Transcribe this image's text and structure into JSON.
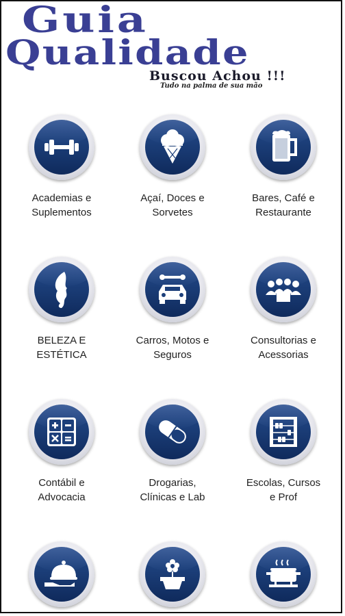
{
  "header": {
    "title_line1": "Guia",
    "title_line2": "Qualidade",
    "slogan": "Buscou Achou !!!",
    "tagline": "Tudo na palma de sua mão"
  },
  "categories": [
    {
      "line1": "Academias e",
      "line2": "Suplementos",
      "icon": "dumbbell-icon"
    },
    {
      "line1": "Açaí, Doces e",
      "line2": "Sorvetes",
      "icon": "ice-cream-icon"
    },
    {
      "line1": "Bares, Café e",
      "line2": "Restaurante",
      "icon": "beer-mug-icon"
    },
    {
      "line1": "BELEZA E",
      "line2": "ESTÉTICA",
      "icon": "beauty-face-icon"
    },
    {
      "line1": "Carros, Motos e",
      "line2": "Seguros",
      "icon": "car-wrench-icon"
    },
    {
      "line1": "Consultorias e",
      "line2": "Acessorias",
      "icon": "people-group-icon"
    },
    {
      "line1": "Contábil e",
      "line2": "Advocacia",
      "icon": "calculator-icon"
    },
    {
      "line1": "Drogarias,",
      "line2": "Clínicas e Lab",
      "icon": "pill-capsule-icon"
    },
    {
      "line1": "Escolas, Cursos",
      "line2": "e Prof",
      "icon": "abacus-icon"
    },
    {
      "line1": "",
      "line2": "",
      "icon": "food-cloche-icon"
    },
    {
      "line1": "",
      "line2": "",
      "icon": "flower-pot-icon"
    },
    {
      "line1": "",
      "line2": "",
      "icon": "cooking-pot-icon"
    }
  ]
}
